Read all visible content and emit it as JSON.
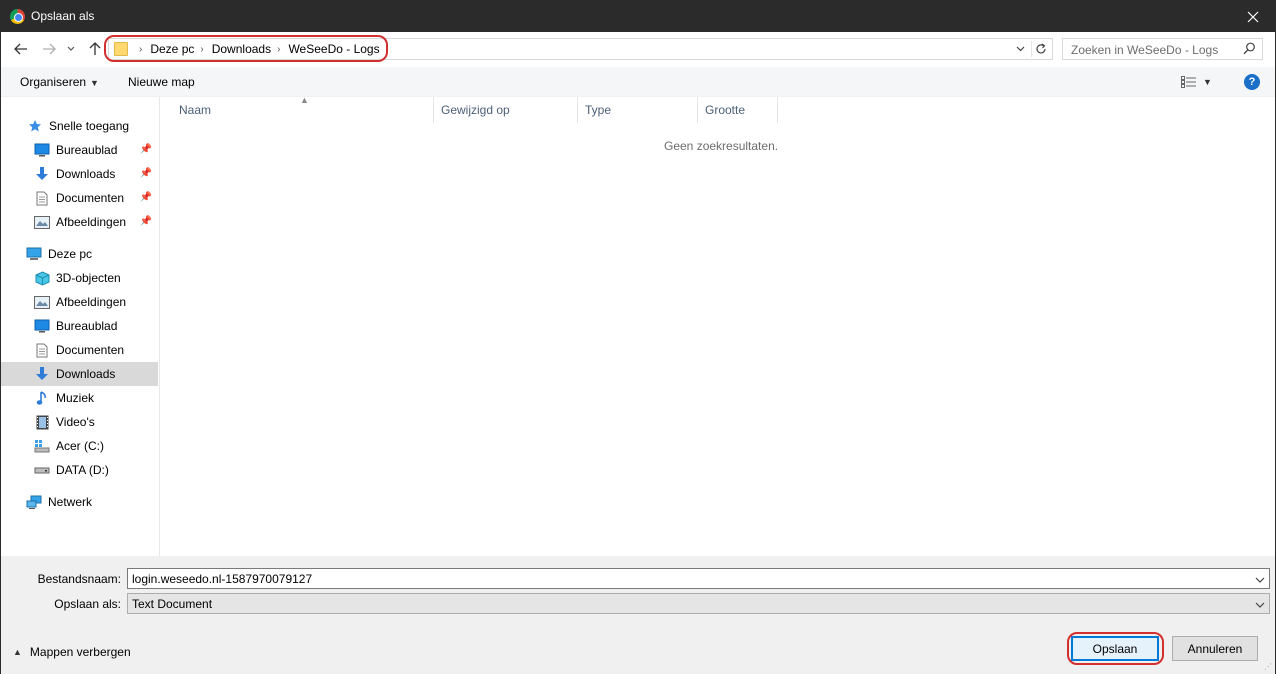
{
  "window": {
    "title": "Opslaan als",
    "close_symbol": "✕"
  },
  "address_bar": {
    "breadcrumbs": [
      "Deze pc",
      "Downloads",
      "WeSeeDo - Logs"
    ],
    "separator": "›"
  },
  "search": {
    "placeholder": "Zoeken in WeSeeDo - Logs"
  },
  "toolbar": {
    "organize_label": "Organiseren",
    "new_folder_label": "Nieuwe map",
    "help_label": "?"
  },
  "sidebar": {
    "quick_access": {
      "label": "Snelle toegang",
      "items": [
        {
          "label": "Bureaublad",
          "icon": "desktop-icon"
        },
        {
          "label": "Downloads",
          "icon": "download-arrow-icon"
        },
        {
          "label": "Documenten",
          "icon": "document-icon"
        },
        {
          "label": "Afbeeldingen",
          "icon": "pictures-icon"
        }
      ]
    },
    "this_pc": {
      "label": "Deze pc",
      "items": [
        {
          "label": "3D-objecten",
          "icon": "cube-3d-icon"
        },
        {
          "label": "Afbeeldingen",
          "icon": "pictures-icon"
        },
        {
          "label": "Bureaublad",
          "icon": "desktop-icon"
        },
        {
          "label": "Documenten",
          "icon": "document-icon"
        },
        {
          "label": "Downloads",
          "icon": "download-arrow-icon"
        },
        {
          "label": "Muziek",
          "icon": "music-note-icon"
        },
        {
          "label": "Video's",
          "icon": "film-icon"
        },
        {
          "label": "Acer (C:)",
          "icon": "system-drive-icon"
        },
        {
          "label": "DATA (D:)",
          "icon": "drive-icon"
        }
      ]
    },
    "network": {
      "label": "Netwerk",
      "icon": "network-icon"
    },
    "selected": "Downloads"
  },
  "file_list": {
    "columns": [
      "Naam",
      "Gewijzigd op",
      "Type",
      "Grootte"
    ],
    "empty_message": "Geen zoekresultaten."
  },
  "form": {
    "filename_label": "Bestandsnaam:",
    "filename_value": "login.weseedo.nl-1587970079127",
    "savetype_label": "Opslaan als:",
    "savetype_value": "Text Document",
    "hide_folders_label": "Mappen verbergen",
    "save_button": "Opslaan",
    "cancel_button": "Annuleren"
  },
  "colors": {
    "titlebar": "#2b2b2b",
    "highlight": "#d32f2f",
    "accent": "#0078d7",
    "selected_row": "#d9d9d9",
    "folder": "#ffd970"
  }
}
